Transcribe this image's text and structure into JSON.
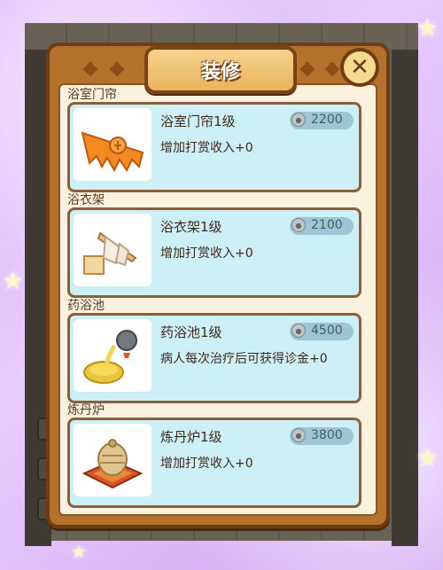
{
  "dialog": {
    "title": "装修",
    "close_icon": "✕",
    "items": [
      {
        "section": "浴室门帘",
        "name": "浴室门帘1级",
        "price": "2200",
        "desc": "增加打赏收入+0",
        "icon": "bath-curtain-icon"
      },
      {
        "section": "浴衣架",
        "name": "浴衣架1级",
        "price": "2100",
        "desc": "增加打赏收入+0",
        "icon": "robe-rack-icon"
      },
      {
        "section": "药浴池",
        "name": "药浴池1级",
        "price": "4500",
        "desc": "病人每次治疗后可获得诊金+0",
        "icon": "medicinal-bath-icon"
      },
      {
        "section": "炼丹炉",
        "name": "炼丹炉1级",
        "price": "3800",
        "desc": "增加打赏收入+0",
        "icon": "alchemy-furnace-icon"
      }
    ]
  },
  "colors": {
    "card_bg": "#cdeff7",
    "panel_border": "#6e3d15",
    "title_bg": "#f7d28e"
  }
}
